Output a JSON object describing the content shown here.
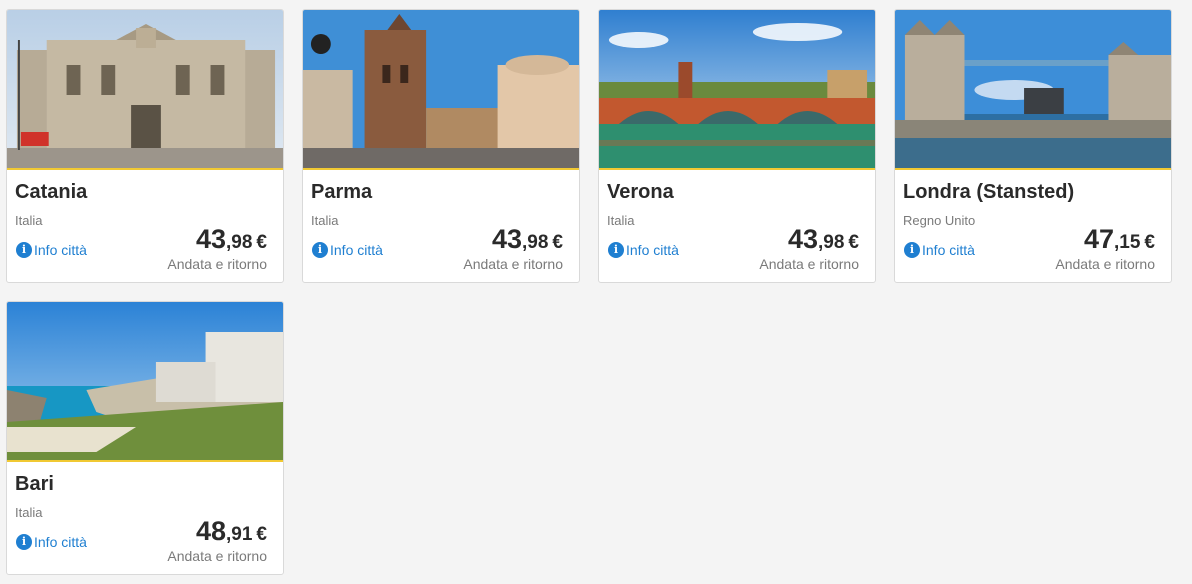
{
  "destinations": [
    {
      "city": "Catania",
      "country": "Italia",
      "info_label": "Info città",
      "price_int": "43",
      "price_dec": ",98",
      "currency": "€",
      "trip_type": "Andata e ritorno"
    },
    {
      "city": "Parma",
      "country": "Italia",
      "info_label": "Info città",
      "price_int": "43",
      "price_dec": ",98",
      "currency": "€",
      "trip_type": "Andata e ritorno"
    },
    {
      "city": "Verona",
      "country": "Italia",
      "info_label": "Info città",
      "price_int": "43",
      "price_dec": ",98",
      "currency": "€",
      "trip_type": "Andata e ritorno"
    },
    {
      "city": "Londra (Stansted)",
      "country": "Regno Unito",
      "info_label": "Info città",
      "price_int": "47",
      "price_dec": ",15",
      "currency": "€",
      "trip_type": "Andata e ritorno"
    },
    {
      "city": "Bari",
      "country": "Italia",
      "info_label": "Info città",
      "price_int": "48",
      "price_dec": ",91",
      "currency": "€",
      "trip_type": "Andata e ritorno"
    }
  ],
  "colors": {
    "accent": "#f1c933",
    "link": "#1f7fd1",
    "text": "#2a2a2a",
    "muted": "#7a7a7a"
  },
  "icons": {
    "info": "info-circle-icon"
  }
}
